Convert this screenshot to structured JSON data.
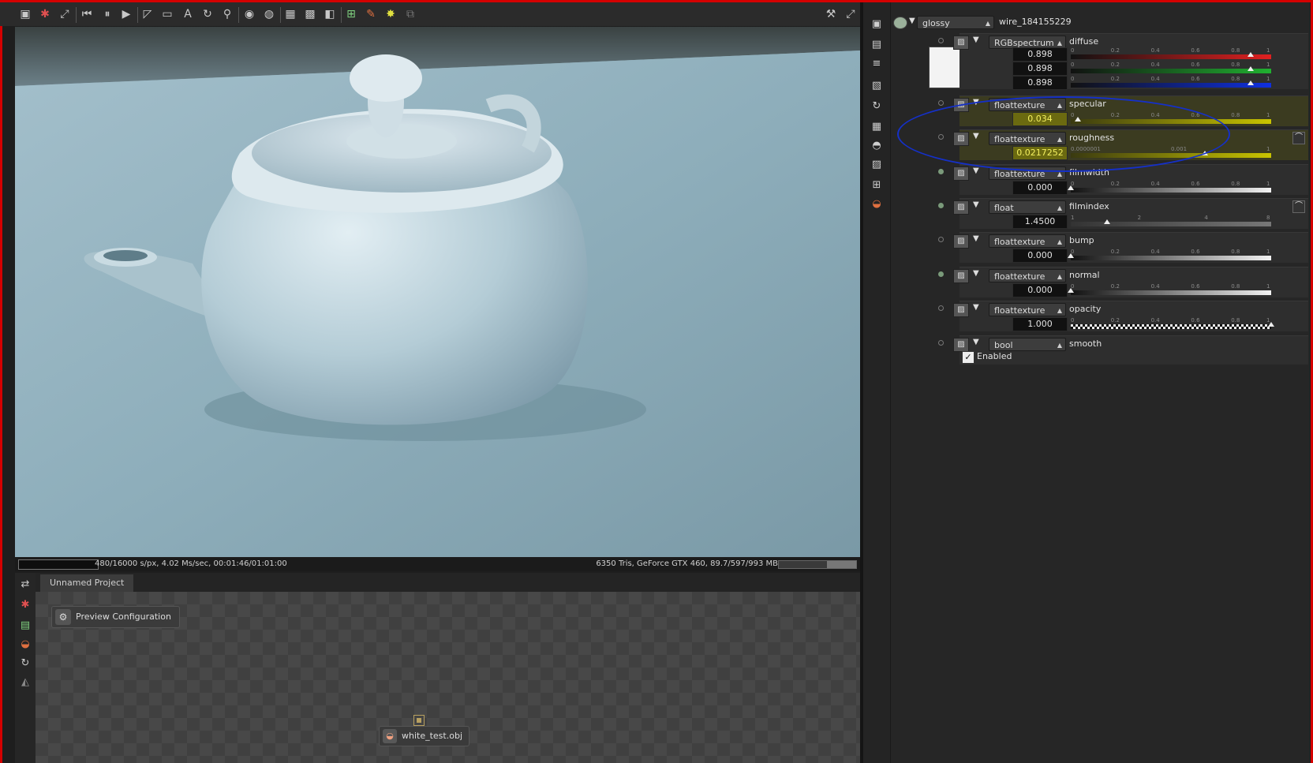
{
  "toolbar": {
    "icons": [
      "camera-icon",
      "clear-icon",
      "fit-icon",
      "rewind-icon",
      "pause-icon",
      "play-icon",
      "pick-icon",
      "display-icon",
      "text-icon",
      "rotate-icon",
      "sphere-icon",
      "lock-icon",
      "grid-icon",
      "checker-icon",
      "tiles-icon",
      "pick-focus-icon",
      "material-pick-icon",
      "light-pick-icon",
      "export-icon"
    ],
    "right_icons": [
      "wrench-icon",
      "fullscreen-icon"
    ]
  },
  "viewport": {
    "status_left": "480/16000 s/px, 4.02 Ms/sec, 00:01:46/01:01:00",
    "status_right": "6350 Tris, GeForce GTX 460, 89.7/597/993 MB"
  },
  "bottom": {
    "tab_label": "Unnamed Project",
    "preview_button": "Preview Configuration",
    "object_node": "white_test.obj"
  },
  "material": {
    "type": "glossy",
    "name": "wire_184155229"
  },
  "params": [
    {
      "id": "diffuse",
      "type": "RGBspectrum",
      "name": "diffuse",
      "values": [
        "0.898",
        "0.898",
        "0.898"
      ],
      "connected": false,
      "channel_colors": [
        "#e02020",
        "#20b030",
        "#1030e0"
      ],
      "fraction": 0.898
    },
    {
      "id": "specular",
      "type": "floattexture",
      "name": "specular",
      "value": "0.034",
      "connected": false,
      "fraction": 0.034,
      "highlight": true
    },
    {
      "id": "roughness",
      "type": "floattexture",
      "name": "roughness",
      "value": "0.0217252",
      "connected": false,
      "fraction": 0.67,
      "highlight": true,
      "ticks": [
        "0.0000001",
        "0.001",
        "1"
      ],
      "curve": true
    },
    {
      "id": "filmwidth",
      "type": "floattexture",
      "name": "filmwidth",
      "value": "0.000",
      "connected": true,
      "fraction": 0.0
    },
    {
      "id": "filmindex",
      "type": "float",
      "name": "filmindex",
      "value": "1.4500",
      "connected": true,
      "fraction": 0.18,
      "ticks": [
        "1",
        "2",
        "4",
        "8"
      ],
      "curve": true
    },
    {
      "id": "bump",
      "type": "floattexture",
      "name": "bump",
      "value": "0.000",
      "connected": false,
      "fraction": 0.0
    },
    {
      "id": "normal",
      "type": "floattexture",
      "name": "normal",
      "value": "0.000",
      "connected": true,
      "fraction": 0.0
    },
    {
      "id": "opacity",
      "type": "floattexture",
      "name": "opacity",
      "value": "1.000",
      "connected": false,
      "fraction": 1.0,
      "checker": true
    },
    {
      "id": "smooth",
      "type": "bool",
      "name": "smooth",
      "checkbox_label": "Enabled",
      "checked": true,
      "connected": false
    }
  ],
  "default_ticks": [
    "0",
    "0.2",
    "0.4",
    "0.6",
    "0.8",
    "1"
  ],
  "colors": {
    "annotation": "#1530c8",
    "highlight": "#c9c400",
    "frame": "#d40000"
  }
}
